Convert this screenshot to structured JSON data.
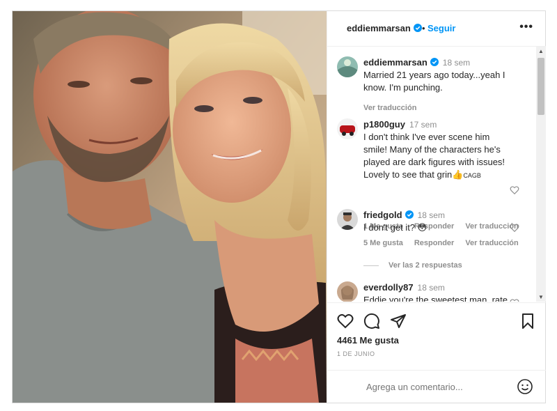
{
  "post": {
    "username": "eddiemmarsan",
    "follow_label": "Seguir",
    "dot": "•",
    "more": "•••"
  },
  "comments": [
    {
      "user": "eddiemmarsan",
      "verified": true,
      "time": "18 sem",
      "text": "Married 21 years ago today...yeah I know. I'm punching.",
      "translate": "Ver traducción"
    },
    {
      "user": "p1800guy",
      "verified": false,
      "time": "17 sem",
      "text": "I don't think I've ever scene him smile! Many of the characters he's played are dark figures with issues! Lovely to see that grin👍",
      "suffix": "CAGB",
      "likes": "1 Me gusta",
      "reply": "Responder",
      "translate": "Ver traducción"
    },
    {
      "user": "friedgold",
      "verified": true,
      "time": "18 sem",
      "text": "I don't get it? 😳",
      "likes": "5 Me gusta",
      "reply": "Responder",
      "translate": "Ver traducción",
      "replies": "Ver las 2 respuestas"
    },
    {
      "user": "everdolly87",
      "verified": false,
      "time": "18 sem",
      "text": "Eddie you're the sweetest man, rate"
    }
  ],
  "likes_count": "4461 Me gusta",
  "date": "1 DE JUNIO",
  "comment_placeholder": "Agrega un comentario...",
  "colors": {
    "accent": "#0095f6",
    "muted": "#8e8e8e",
    "text": "#262626",
    "border": "#dbdbdb"
  },
  "icons": [
    "heart-icon",
    "comment-icon",
    "share-icon",
    "bookmark-icon",
    "emoji-icon",
    "verified-icon",
    "more-icon"
  ]
}
